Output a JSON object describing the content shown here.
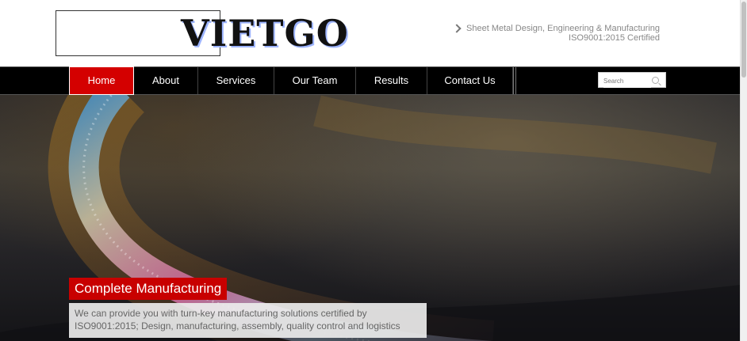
{
  "header": {
    "logo_text": "VIETGO",
    "tagline_line1": "Sheet Metal Design, Engineering & Manufacturing",
    "tagline_line2": "ISO9001:2015 Certified"
  },
  "nav": {
    "items": [
      {
        "label": "Home",
        "active": true
      },
      {
        "label": "About",
        "active": false
      },
      {
        "label": "Services",
        "active": false
      },
      {
        "label": "Our Team",
        "active": false
      },
      {
        "label": "Results",
        "active": false
      },
      {
        "label": "Contact Us",
        "active": false
      }
    ],
    "search_placeholder": "Search"
  },
  "hero": {
    "title": "Complete Manufacturing",
    "text": "We can provide you with turn-key manufacturing solutions certified by ISO9001:2015; Design, manufacturing, assembly, quality control and logistics"
  },
  "colors": {
    "accent": "#d40000",
    "nav_bg": "#000000"
  },
  "icons": [
    "chevron-right-icon",
    "search-icon"
  ]
}
